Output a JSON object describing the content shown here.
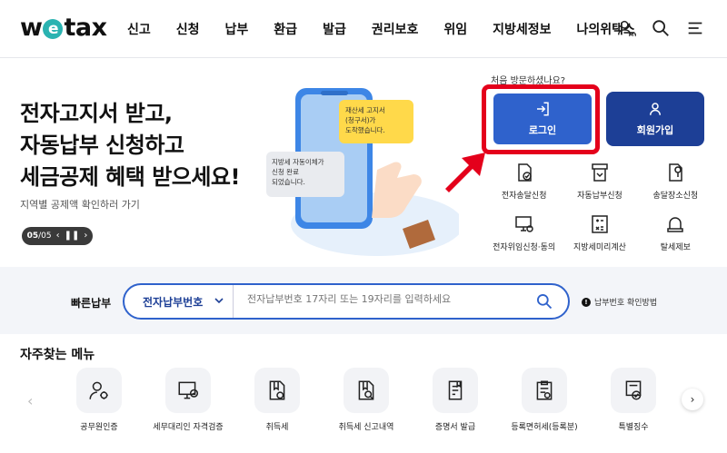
{
  "header": {
    "logo_prefix": "w",
    "logo_e": "e",
    "logo_suffix": "tax",
    "nav": [
      "신고",
      "신청",
      "납부",
      "환급",
      "발급",
      "권리보호",
      "위임",
      "지방세정보",
      "나의위택스"
    ],
    "my_label": "MY",
    "icons": [
      "user-icon",
      "search-icon",
      "menu-icon"
    ]
  },
  "hero": {
    "title_lines": [
      "전자고지서 받고,",
      "자동납부 신청하고",
      "세금공제 혜택 받으세요!"
    ],
    "subtitle": "지역별 공제액 확인하러 가기",
    "slide_current": "05",
    "slide_total": "05",
    "bubble1": "재산세 고지서\n(청구서)가\n도착했습니다.",
    "bubble2": "지방세 자동이체가\n신청 완료\n되었습니다."
  },
  "account": {
    "first_visit": "처음 방문하셨나요?",
    "login_label": "로그인",
    "join_label": "회원가입",
    "highlight_color": "#e4001b",
    "login_color": "#2f62cc",
    "join_color": "#1d3f96"
  },
  "quick_menu": [
    {
      "label": "전자송달신청",
      "icon": "document-check-icon"
    },
    {
      "label": "자동납부신청",
      "icon": "auto-pay-icon"
    },
    {
      "label": "송달장소신청",
      "icon": "location-doc-icon"
    },
    {
      "label": "전자위임신청·동의",
      "icon": "delegate-icon"
    },
    {
      "label": "지방세미리계산",
      "icon": "calculator-icon"
    },
    {
      "label": "탈세제보",
      "icon": "bell-icon"
    }
  ],
  "fastpay": {
    "label": "빠른납부",
    "select_value": "전자납부번호",
    "placeholder": "전자납부번호 17자리 또는 19자리를 입력하세요",
    "help": "납부번호 확인방법"
  },
  "frequent": {
    "title": "자주찾는 메뉴",
    "items": [
      {
        "label": "공무원인증",
        "icon": "officer-cert-icon"
      },
      {
        "label": "세무대리인 자격검증",
        "icon": "monitor-check-icon"
      },
      {
        "label": "취득세",
        "icon": "tax-doc-icon"
      },
      {
        "label": "취득세 신고내역",
        "icon": "doc-search-icon"
      },
      {
        "label": "증명서 발급",
        "icon": "certificate-icon"
      },
      {
        "label": "등록면허세(등록분)",
        "icon": "clipboard-icon"
      },
      {
        "label": "특별징수",
        "icon": "special-tax-icon"
      }
    ]
  }
}
